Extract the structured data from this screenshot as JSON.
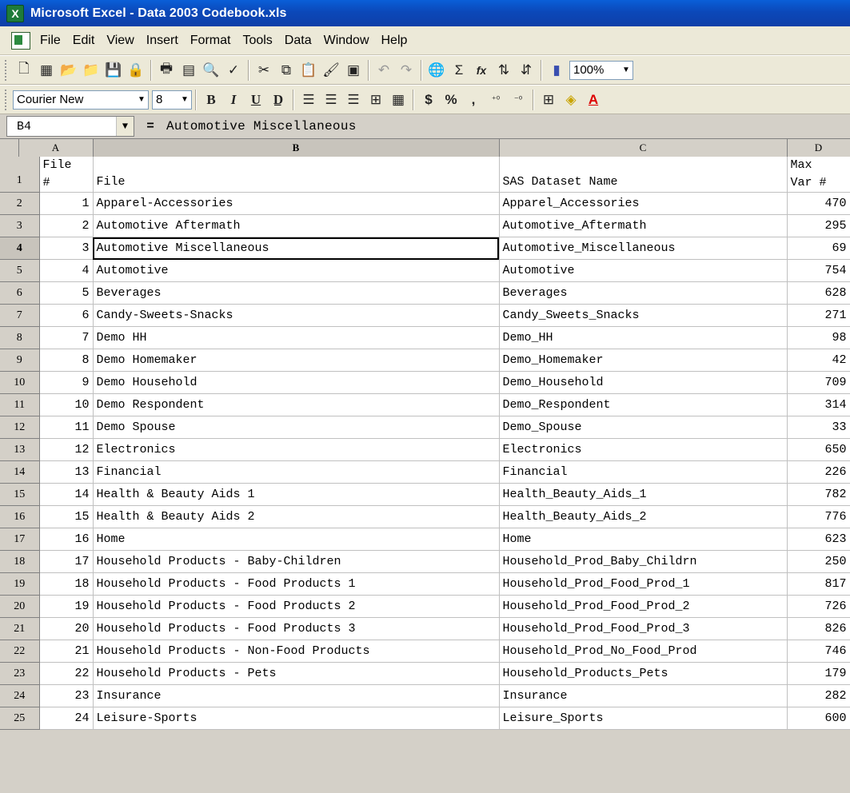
{
  "window": {
    "title": "Microsoft Excel - Data 2003 Codebook.xls",
    "app_icon": "excel-icon"
  },
  "menu": [
    "File",
    "Edit",
    "View",
    "Insert",
    "Format",
    "Tools",
    "Data",
    "Window",
    "Help"
  ],
  "toolbar": {
    "zoom": "100%",
    "font": "Courier New",
    "font_size": "8",
    "bold": "B",
    "italic": "I",
    "underline": "U",
    "currency": "$",
    "percent": "%",
    "comma": ",",
    "sum": "Σ",
    "fx": "fx"
  },
  "formula_bar": {
    "name_box": "B4",
    "equals": "=",
    "value": "Automotive Miscellaneous"
  },
  "columns": [
    "A",
    "B",
    "C",
    "D"
  ],
  "header_row": {
    "row": "1",
    "a_line1": "File",
    "a_line2": "#",
    "b": "File",
    "c": "SAS Dataset Name",
    "d_line1": "Max",
    "d_line2": "Var #"
  },
  "rows": [
    {
      "row": "2",
      "a": "1",
      "b": "Apparel-Accessories",
      "c": "Apparel_Accessories",
      "d": "470"
    },
    {
      "row": "3",
      "a": "2",
      "b": "Automotive Aftermath",
      "c": "Automotive_Aftermath",
      "d": "295"
    },
    {
      "row": "4",
      "a": "3",
      "b": "Automotive Miscellaneous",
      "c": "Automotive_Miscellaneous",
      "d": "69"
    },
    {
      "row": "5",
      "a": "4",
      "b": "Automotive",
      "c": "Automotive",
      "d": "754"
    },
    {
      "row": "6",
      "a": "5",
      "b": "Beverages",
      "c": "Beverages",
      "d": "628"
    },
    {
      "row": "7",
      "a": "6",
      "b": "Candy-Sweets-Snacks",
      "c": "Candy_Sweets_Snacks",
      "d": "271"
    },
    {
      "row": "8",
      "a": "7",
      "b": "Demo HH",
      "c": "Demo_HH",
      "d": "98"
    },
    {
      "row": "9",
      "a": "8",
      "b": "Demo Homemaker",
      "c": "Demo_Homemaker",
      "d": "42"
    },
    {
      "row": "10",
      "a": "9",
      "b": "Demo Household",
      "c": "Demo_Household",
      "d": "709"
    },
    {
      "row": "11",
      "a": "10",
      "b": "Demo Respondent",
      "c": "Demo_Respondent",
      "d": "314"
    },
    {
      "row": "12",
      "a": "11",
      "b": "Demo Spouse",
      "c": "Demo_Spouse",
      "d": "33"
    },
    {
      "row": "13",
      "a": "12",
      "b": "Electronics",
      "c": "Electronics",
      "d": "650"
    },
    {
      "row": "14",
      "a": "13",
      "b": "Financial",
      "c": "Financial",
      "d": "226"
    },
    {
      "row": "15",
      "a": "14",
      "b": "Health & Beauty Aids 1",
      "c": "Health_Beauty_Aids_1",
      "d": "782"
    },
    {
      "row": "16",
      "a": "15",
      "b": "Health & Beauty Aids 2",
      "c": "Health_Beauty_Aids_2",
      "d": "776"
    },
    {
      "row": "17",
      "a": "16",
      "b": "Home",
      "c": "Home",
      "d": "623"
    },
    {
      "row": "18",
      "a": "17",
      "b": "Household Products - Baby-Children",
      "c": "Household_Prod_Baby_Childrn",
      "d": "250"
    },
    {
      "row": "19",
      "a": "18",
      "b": "Household Products - Food Products 1",
      "c": "Household_Prod_Food_Prod_1",
      "d": "817"
    },
    {
      "row": "20",
      "a": "19",
      "b": "Household Products - Food Products 2",
      "c": "Household_Prod_Food_Prod_2",
      "d": "726"
    },
    {
      "row": "21",
      "a": "20",
      "b": "Household Products - Food Products 3",
      "c": "Household_Prod_Food_Prod_3",
      "d": "826"
    },
    {
      "row": "22",
      "a": "21",
      "b": "Household Products - Non-Food Products",
      "c": "Household_Prod_No_Food_Prod",
      "d": "746"
    },
    {
      "row": "23",
      "a": "22",
      "b": "Household Products - Pets",
      "c": "Household_Products_Pets",
      "d": "179"
    },
    {
      "row": "24",
      "a": "23",
      "b": "Insurance",
      "c": "Insurance",
      "d": "282"
    },
    {
      "row": "25",
      "a": "24",
      "b": "Leisure-Sports",
      "c": "Leisure_Sports",
      "d": "600"
    }
  ]
}
